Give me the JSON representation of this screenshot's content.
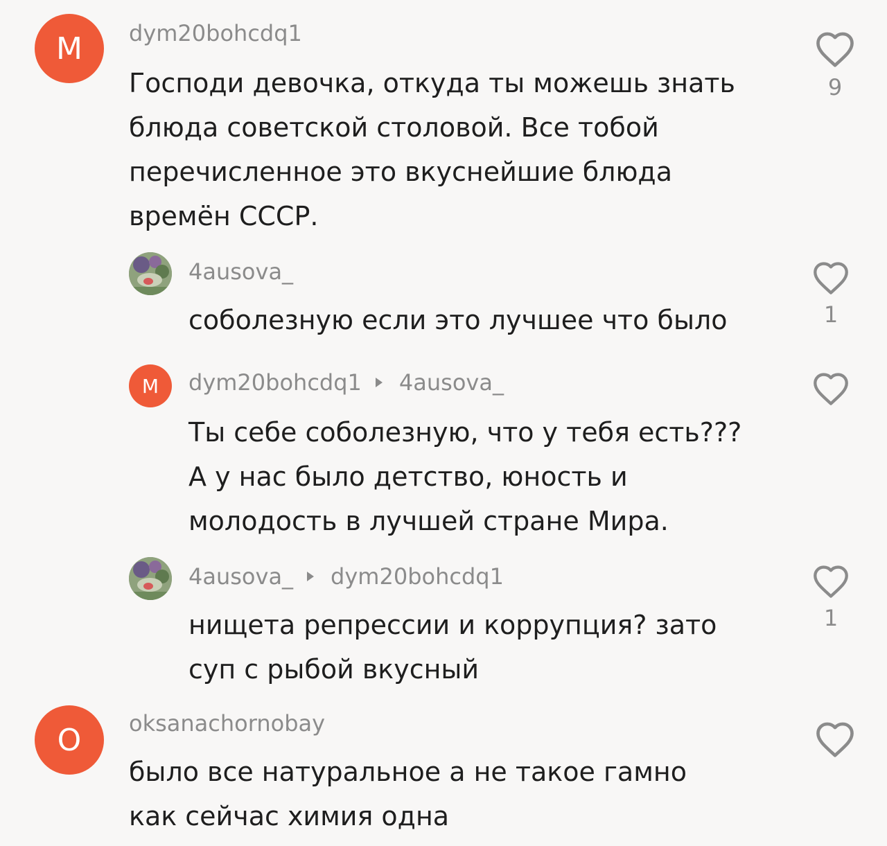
{
  "comments": [
    {
      "avatar_letter": "M",
      "avatar_color": "#ef5a38",
      "username": "dym20bohcdq1",
      "text": "Господи девочка, откуда ты можешь знать\nблюда советской столовой. Все тобой\nперечисленное это вкуснейшие блюда\nвремён СССР.",
      "likes": "9"
    },
    {
      "avatar_icon": "profile-photo",
      "username": "4ausova_",
      "text": "соболезную если это лучшее что было",
      "likes": "1"
    },
    {
      "avatar_letter": "M",
      "avatar_color": "#ef5a38",
      "username": "dym20bohcdq1",
      "reply_to": "4ausova_",
      "text": "Ты себе соболезную, что у тебя есть???\nА у нас было детство, юность и\nмолодость в лучшей стране Мира.",
      "likes": ""
    },
    {
      "avatar_icon": "profile-photo",
      "username": "4ausova_",
      "reply_to": "dym20bohcdq1",
      "text": "нищета репрессии и коррупция? зато\nсуп с рыбой вкусный",
      "likes": "1"
    },
    {
      "avatar_letter": "O",
      "avatar_color": "#ef5a38",
      "username": "oksanachornobay",
      "text": "было все натуральное а не такое гамно\nкак сейчас химия одна",
      "likes": ""
    }
  ],
  "icons": {
    "like": "heart-outline-icon",
    "reply_separator": "caret-right-icon"
  }
}
